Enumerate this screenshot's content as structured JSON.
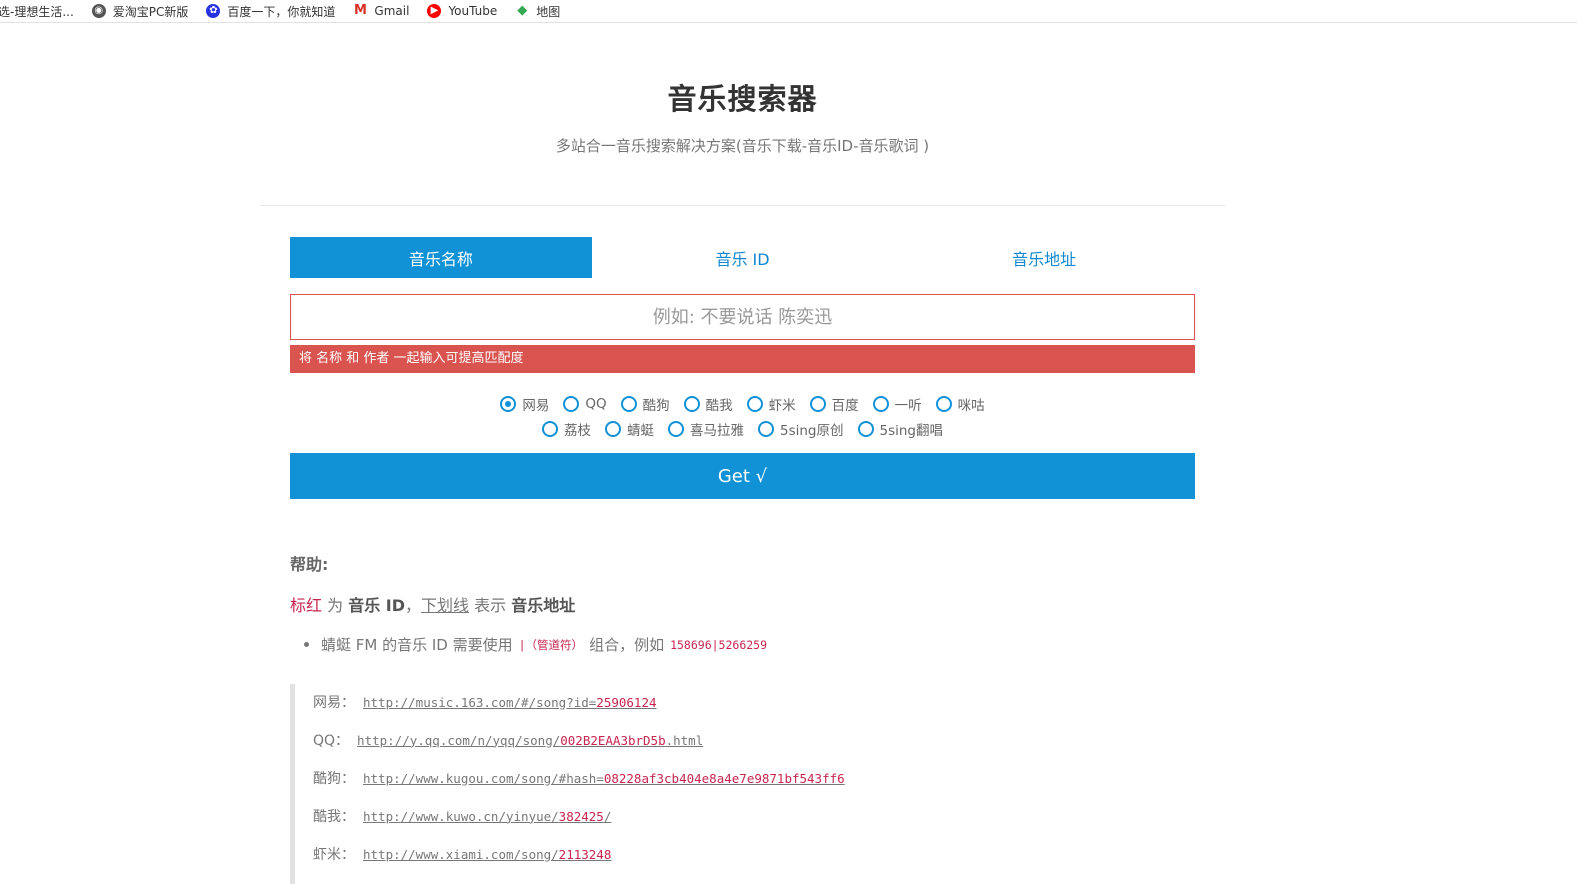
{
  "bookmarks": [
    {
      "label": "选-理想生活...",
      "icon": "text-icon"
    },
    {
      "label": "爱淘宝PC新版",
      "icon": "globe-icon"
    },
    {
      "label": "百度一下，你就知道",
      "icon": "baidu-icon"
    },
    {
      "label": "Gmail",
      "icon": "gmail-icon"
    },
    {
      "label": "YouTube",
      "icon": "youtube-icon"
    },
    {
      "label": "地图",
      "icon": "maps-icon"
    }
  ],
  "page": {
    "title": "音乐搜索器",
    "subtitle": "多站合一音乐搜索解决方案(音乐下载-音乐ID-音乐歌词 )"
  },
  "tabs": [
    {
      "label": "音乐名称",
      "active": true
    },
    {
      "label": "音乐 ID",
      "active": false
    },
    {
      "label": "音乐地址",
      "active": false
    }
  ],
  "search": {
    "placeholder": "例如: 不要说话 陈奕迅",
    "value": "",
    "hint": "将 名称 和 作者 一起输入可提高匹配度"
  },
  "sources_row1": [
    {
      "label": "网易",
      "selected": true
    },
    {
      "label": "QQ",
      "selected": false
    },
    {
      "label": "酷狗",
      "selected": false
    },
    {
      "label": "酷我",
      "selected": false
    },
    {
      "label": "虾米",
      "selected": false
    },
    {
      "label": "百度",
      "selected": false
    },
    {
      "label": "一听",
      "selected": false
    },
    {
      "label": "咪咕",
      "selected": false
    }
  ],
  "sources_row2": [
    {
      "label": "荔枝",
      "selected": false
    },
    {
      "label": "蜻蜓",
      "selected": false
    },
    {
      "label": "喜马拉雅",
      "selected": false
    },
    {
      "label": "5sing原创",
      "selected": false
    },
    {
      "label": "5sing翻唱",
      "selected": false
    }
  ],
  "get_button": "Get √",
  "help": {
    "title": "帮助:",
    "legend": {
      "red": "标红",
      "t1": "为",
      "id_label": "音乐 ID",
      "t2": "，",
      "underline": "下划线",
      "t3": "表示",
      "url_label": "音乐地址"
    },
    "bullet": {
      "text1": "蜻蜓 FM 的音乐 ID 需要使用",
      "pipe_code": "|（管道符）",
      "text2": "组合，例如",
      "example_code": "158696|5266259"
    },
    "examples": [
      {
        "label": "网易：",
        "url_prefix": "http://music.163.com/#/song?id=",
        "id": "25906124",
        "url_suffix": ""
      },
      {
        "label": "QQ：",
        "url_prefix": "http://y.qq.com/n/yqq/song/",
        "id": "002B2EAA3brD5b",
        "url_suffix": ".html"
      },
      {
        "label": "酷狗：",
        "url_prefix": "http://www.kugou.com/song/#hash=",
        "id": "08228af3cb404e8a4e7e9871bf543ff6",
        "url_suffix": ""
      },
      {
        "label": "酷我：",
        "url_prefix": "http://www.kuwo.cn/yinyue/",
        "id": "382425",
        "url_suffix": "/"
      },
      {
        "label": "虾米：",
        "url_prefix": "http://www.xiami.com/song/",
        "id": "2113248",
        "url_suffix": ""
      }
    ]
  },
  "colors": {
    "primary": "#1191d6",
    "danger": "#d9534f",
    "code_red": "#c7254e"
  }
}
